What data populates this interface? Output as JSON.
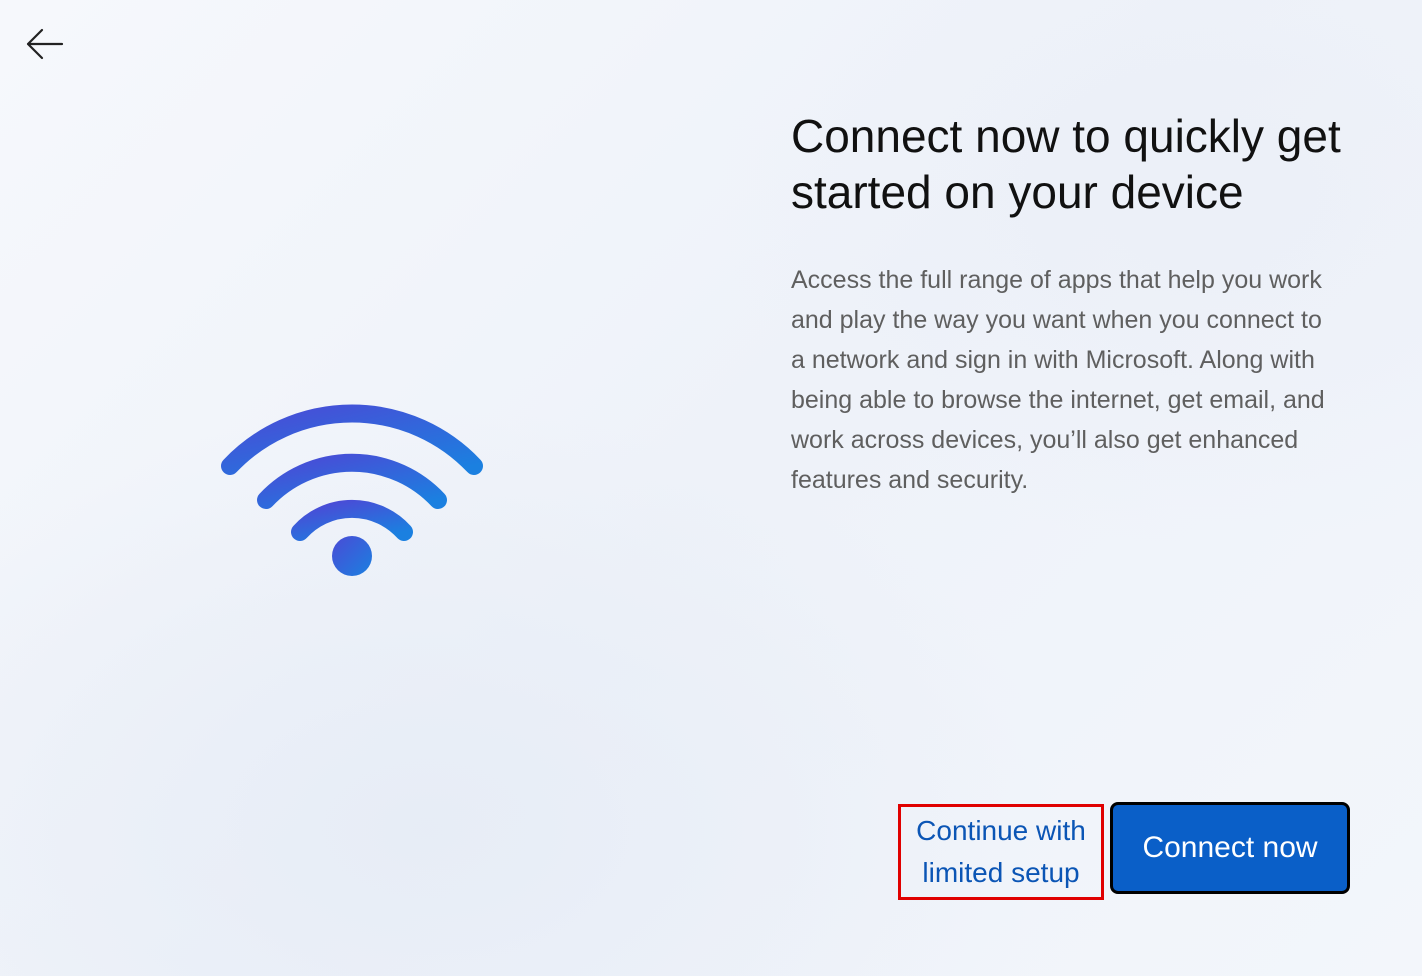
{
  "nav": {
    "back_icon": "arrow-left-icon"
  },
  "illustration": {
    "icon": "wifi-icon",
    "gradient_start": "#4b4fd8",
    "gradient_end": "#1a7fe0"
  },
  "content": {
    "title": "Connect now to quickly get started on your device",
    "description": "Access the full range of apps that help you work and play the way you want when you connect to a network and sign in with Microsoft. Along with being able to browse the internet, get email, and work across devices, you’ll also get enhanced features and security."
  },
  "actions": {
    "limited_setup_line1": "Continue with",
    "limited_setup_line2": "limited setup",
    "connect_now": "Connect now"
  },
  "colors": {
    "accent": "#0a5fc8",
    "link": "#0b55b5",
    "highlight_border": "#e00000"
  }
}
